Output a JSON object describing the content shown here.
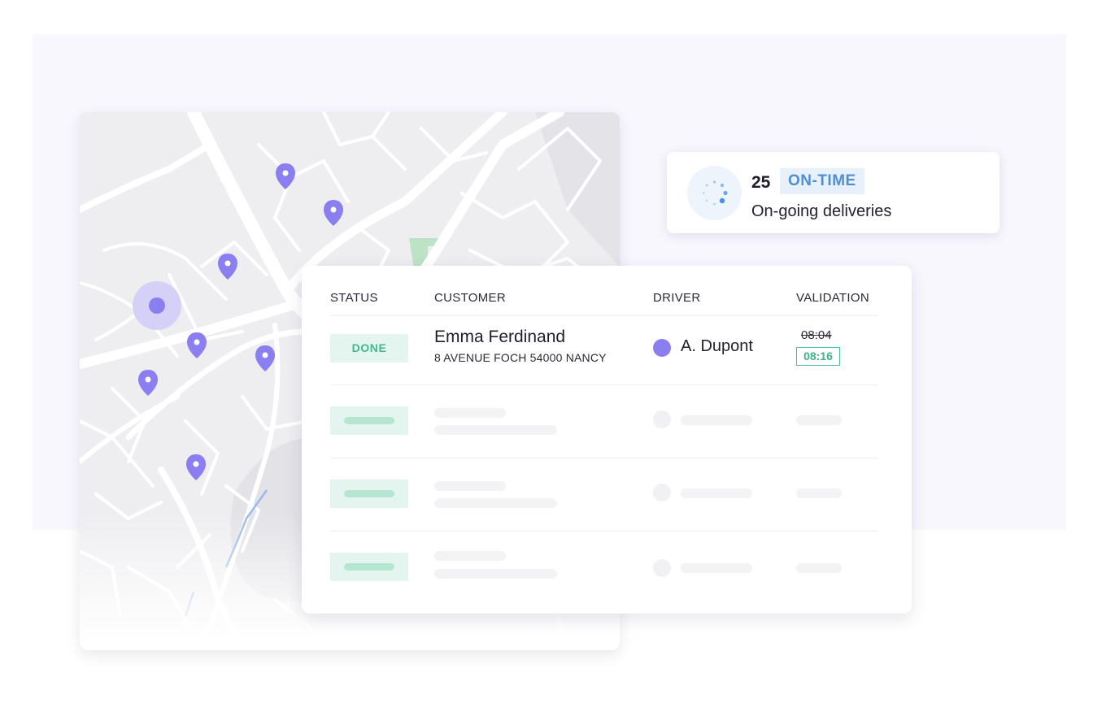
{
  "stats": {
    "count": "25",
    "badge": "ON-TIME",
    "label": "On-going deliveries",
    "icon": "loading-dots-icon"
  },
  "table": {
    "headers": {
      "status": "STATUS",
      "customer": "CUSTOMER",
      "driver": "DRIVER",
      "validation": "VALIDATION"
    },
    "rows": [
      {
        "status": "DONE",
        "customer_name": "Emma Ferdinand",
        "customer_address": "8 AVENUE FOCH 54000 NANCY",
        "driver": "A. Dupont",
        "planned_time": "08:04",
        "validated_time": "08:16"
      }
    ],
    "placeholder_rows": 3
  },
  "map": {
    "pins": 8,
    "current_location_marker": true
  },
  "colors": {
    "accent_purple": "#8a7ef0",
    "done_green": "#41b98c",
    "on_time_blue": "#4f8fd6",
    "backdrop": "#f8f7fe"
  }
}
